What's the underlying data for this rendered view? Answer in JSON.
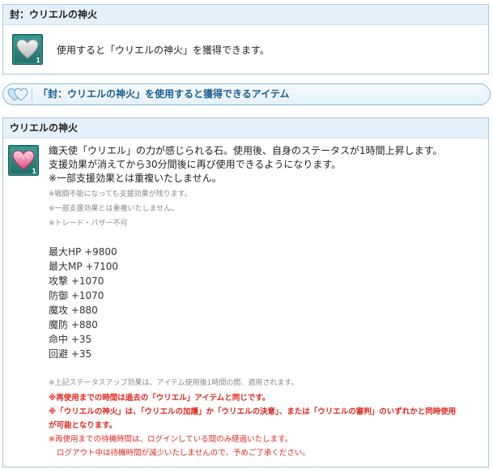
{
  "seal_box": {
    "title": "封：ウリエルの神火",
    "icon": "gray-heart-icon",
    "quantity": "1",
    "description": "使用すると「ウリエルの神火」を獲得できます。"
  },
  "banner": {
    "icon": "double-heart-icon",
    "text": "「封：ウリエルの神火」を使用すると獲得できるアイテム"
  },
  "item_box": {
    "title": "ウリエルの神火",
    "icon": "pink-heart-icon",
    "quantity": "1",
    "description_lines": [
      "織天使「ウリエル」の力が感じられる石。使用後、自身のステータスが1時間上昇します。",
      "支援効果が消えてから30分間後に再び使用できるようになります。",
      "※一部支援効果とは重複いたしません。"
    ],
    "small_notes": [
      "※戦闘不能になっても支援効果が残ります。",
      "※一部支援効果とは重複いたしません。",
      "※トレード・バザー不可"
    ],
    "stats": [
      "最大HP +9800",
      "最大MP +7100",
      "攻撃 +1070",
      "防御 +1070",
      "魔攻 +880",
      "魔防 +880",
      "命中 +35",
      "回避 +35"
    ],
    "footer_note": "※上記ステータスアップ効果は、アイテム使用後1時間の間、適用されます。",
    "red_bold_lines": [
      "※再使用までの時間は過去の「ウリエル」アイテムと同じです。",
      "※「ウリエルの神火」は、「ウリエルの加護」か「ウリエルの決意」、または「ウリエルの審判」のいずれかと同時使用",
      "が可能となります。"
    ],
    "red_lines": [
      "※再使用までの待機時間は、ログインしている間のみ経過いたします。",
      "ログアウト中は待機時間が減少いたしませんので、予めご了承ください。"
    ]
  },
  "colors": {
    "header_bg": "#e4f1fb",
    "border": "#a9c6dc",
    "banner_text": "#1c5d8c",
    "warning_red": "#e2271d"
  }
}
